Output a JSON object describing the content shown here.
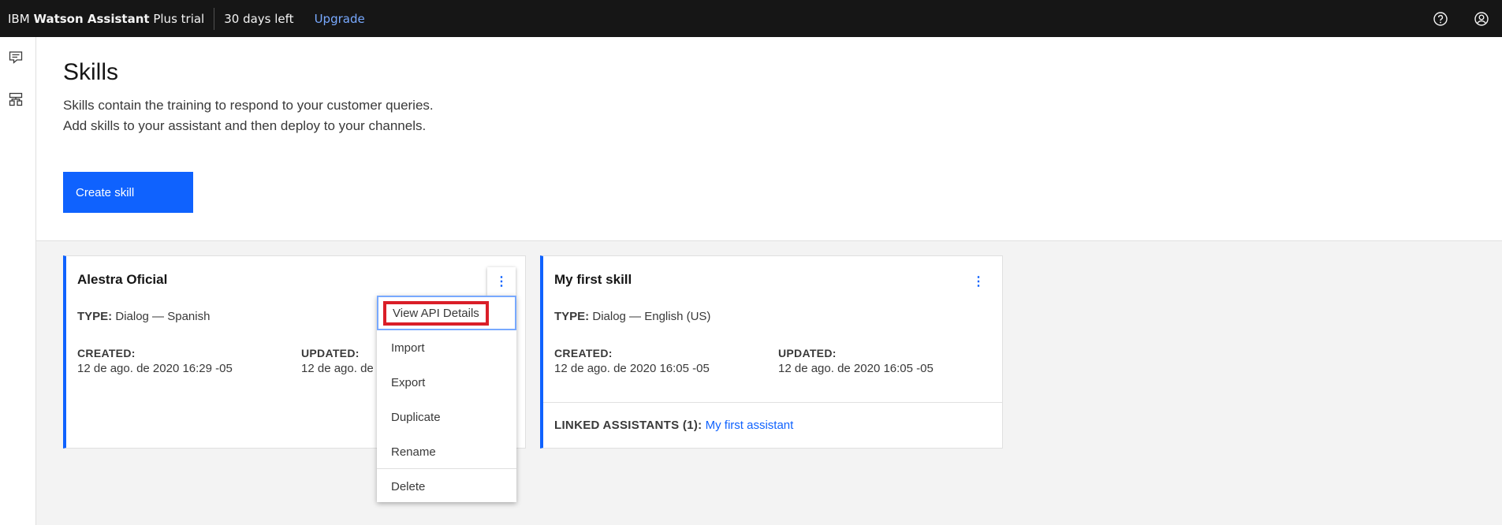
{
  "topbar": {
    "brand_prefix": "IBM",
    "brand_bold": "Watson Assistant",
    "brand_suffix": "Plus trial",
    "days_left": "30 days left",
    "upgrade_label": "Upgrade",
    "icons": [
      "help-icon",
      "user-profile-icon"
    ]
  },
  "rail": {
    "icons": [
      "assistants-icon",
      "skills-icon"
    ]
  },
  "page": {
    "title": "Skills",
    "description": "Skills contain the training to respond to your customer queries. Add skills to your assistant and then deploy to your channels.",
    "create_button": "Create skill"
  },
  "cards": [
    {
      "title": "Alestra Oficial",
      "type_label": "TYPE:",
      "type_value": "Dialog — Spanish",
      "created_label": "CREATED:",
      "created_value": "12 de ago. de 2020 16:29 -05",
      "updated_label": "UPDATED:",
      "updated_value": "12 de ago. de 2020 16:29 -05",
      "kebab": "⋮"
    },
    {
      "title": "My first skill",
      "type_label": "TYPE:",
      "type_value": "Dialog — English (US)",
      "created_label": "CREATED:",
      "created_value": "12 de ago. de 2020 16:05 -05",
      "updated_label": "UPDATED:",
      "updated_value": "12 de ago. de 2020 16:05 -05",
      "linked_label": "LINKED ASSISTANTS (1):",
      "linked_value": "My first assistant",
      "kebab": "⋮"
    }
  ],
  "menu": {
    "items": [
      "View API Details",
      "Import",
      "Export",
      "Duplicate",
      "Rename",
      "Delete"
    ]
  },
  "colors": {
    "accent": "#0f62fe",
    "highlight": "#da1e28"
  }
}
